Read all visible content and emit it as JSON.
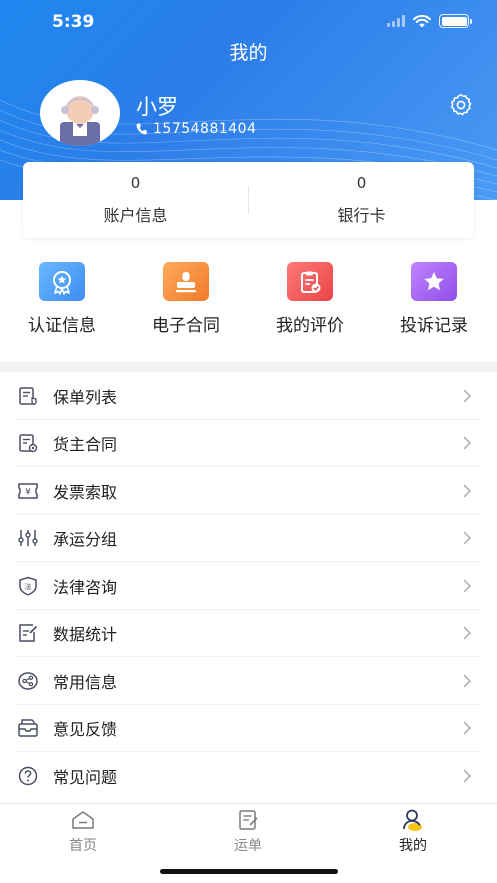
{
  "status_bar": {
    "time": "5:39"
  },
  "header": {
    "title": "我的"
  },
  "profile": {
    "name": "小罗",
    "phone": "15754881404"
  },
  "account": [
    {
      "value": "0",
      "label": "账户信息"
    },
    {
      "value": "0",
      "label": "银行卡"
    }
  ],
  "quick_actions": [
    {
      "label": "认证信息",
      "icon": "certification-icon",
      "color": "#4a9ff5"
    },
    {
      "label": "电子合同",
      "icon": "stamp-icon",
      "color": "#f5893a"
    },
    {
      "label": "我的评价",
      "icon": "evaluation-icon",
      "color": "#f05a5a"
    },
    {
      "label": "投诉记录",
      "icon": "star-icon",
      "color": "#a05cf0"
    }
  ],
  "menu": [
    {
      "label": "保单列表",
      "icon": "policy-list-icon"
    },
    {
      "label": "货主合同",
      "icon": "shipper-contract-icon"
    },
    {
      "label": "发票索取",
      "icon": "invoice-icon"
    },
    {
      "label": "承运分组",
      "icon": "carrier-group-icon"
    },
    {
      "label": "法律咨询",
      "icon": "legal-icon"
    },
    {
      "label": "数据统计",
      "icon": "statistics-icon"
    },
    {
      "label": "常用信息",
      "icon": "share-icon"
    },
    {
      "label": "意见反馈",
      "icon": "feedback-icon"
    },
    {
      "label": "常见问题",
      "icon": "question-icon"
    }
  ],
  "tabbar": [
    {
      "label": "首页",
      "icon": "home-icon",
      "active": false
    },
    {
      "label": "运单",
      "icon": "waybill-icon",
      "active": false
    },
    {
      "label": "我的",
      "icon": "profile-icon",
      "active": true
    }
  ],
  "colors": {
    "primary": "#2c7de8",
    "text": "#222222",
    "icon_stroke": "#4a4f63"
  }
}
